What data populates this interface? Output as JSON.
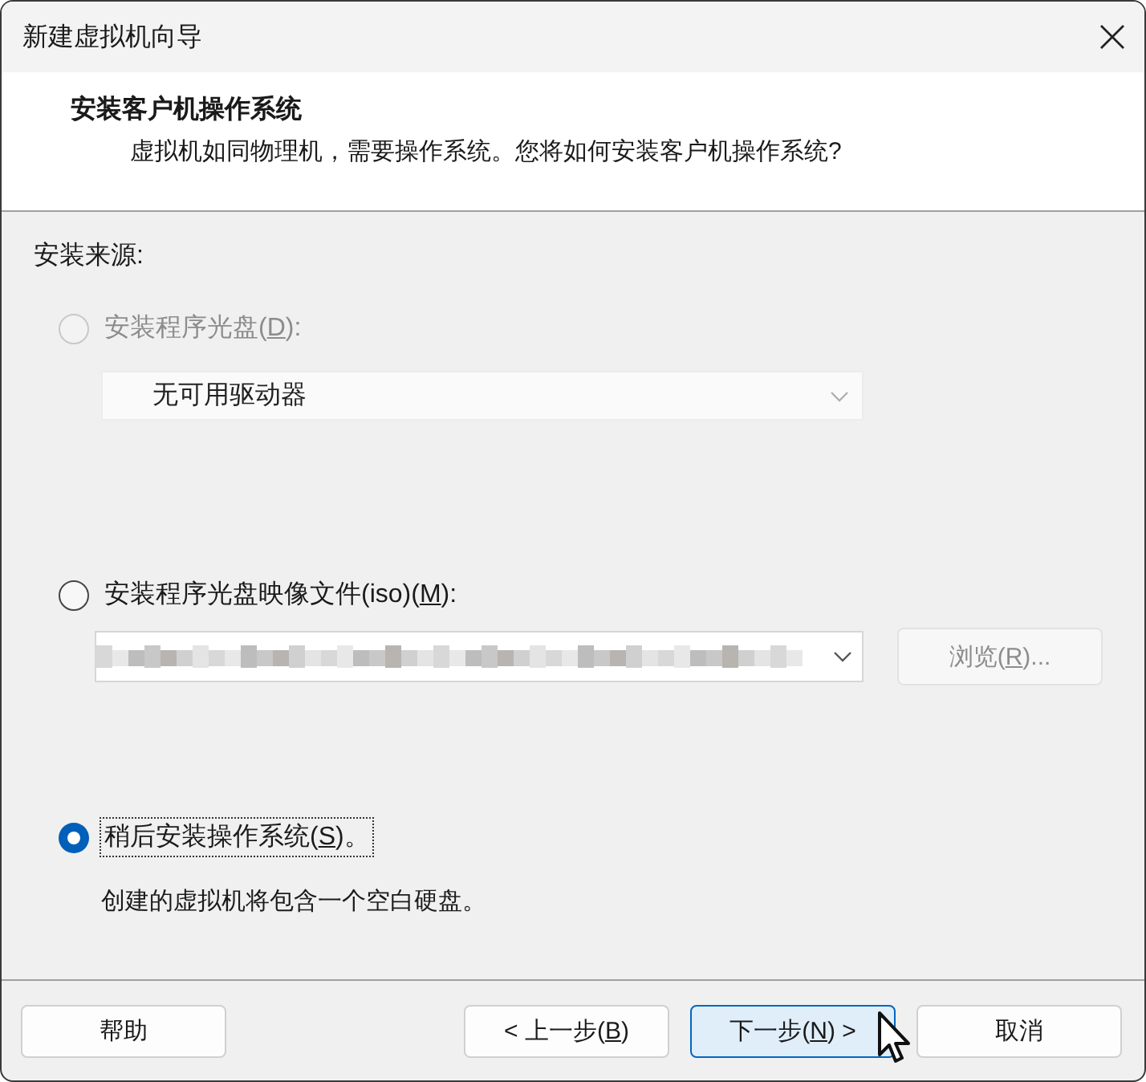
{
  "window": {
    "title": "新建虚拟机向导"
  },
  "header": {
    "title": "安装客户机操作系统",
    "subtitle": "虚拟机如同物理机，需要操作系统。您将如何安装客户机操作系统?"
  },
  "section_label": "安装来源:",
  "options": [
    {
      "kind": "disc",
      "before": "安装程序光盘(",
      "key": "D",
      "after": "):",
      "selected": false,
      "disabled": true,
      "focused": false,
      "combo": {
        "value": "无可用驱动器",
        "disabled": true
      }
    },
    {
      "kind": "iso",
      "before": "安装程序光盘映像文件(iso)(",
      "key": "M",
      "after": "):",
      "selected": false,
      "disabled": false,
      "focused": false,
      "browse": {
        "before": "浏览(",
        "key": "R",
        "after": ")...",
        "disabled": true
      }
    },
    {
      "kind": "later",
      "before": "稍后安装操作系统(",
      "key": "S",
      "after": ")。",
      "selected": true,
      "disabled": false,
      "focused": true,
      "note": "创建的虚拟机将包含一个空白硬盘。"
    }
  ],
  "buttons": [
    {
      "label": "帮助",
      "default": false
    },
    {
      "before": "< 上一步(",
      "key": "B",
      "after": ")",
      "default": false
    },
    {
      "before": "下一步(",
      "key": "N",
      "after": ") >",
      "default": true
    },
    {
      "label": "取消",
      "default": false
    }
  ]
}
